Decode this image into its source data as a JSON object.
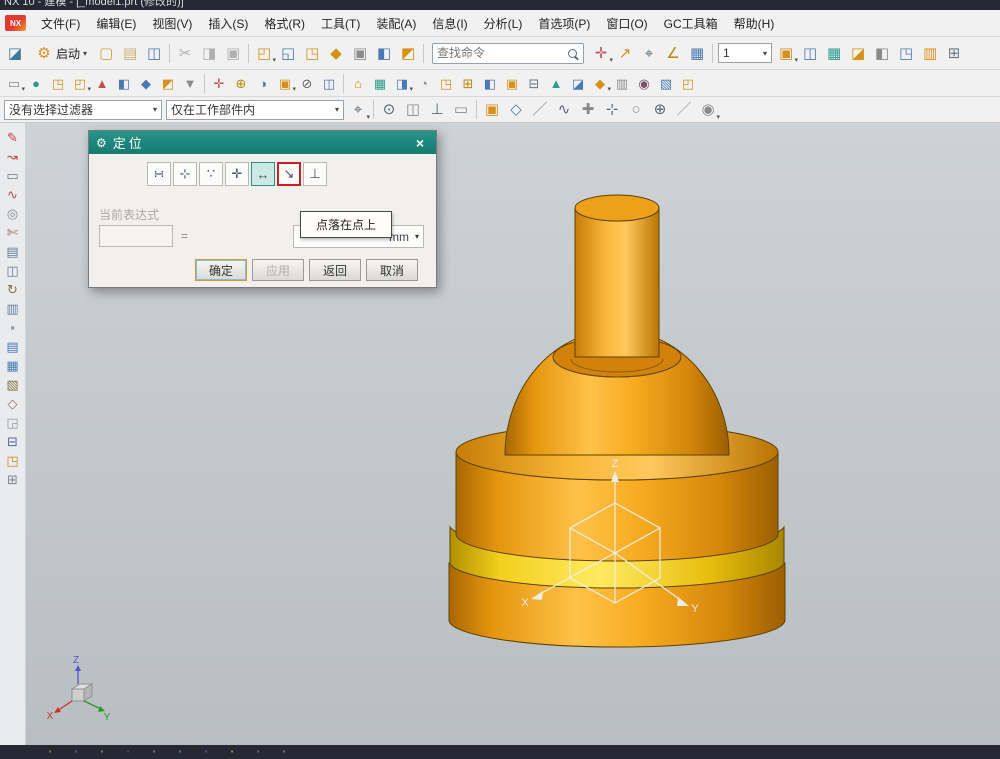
{
  "window": {
    "title": "NX 10 - 建模 - [_model1.prt (修改的)]",
    "logo": "NX"
  },
  "menu": {
    "items": [
      {
        "t": "文件(F)",
        "n": "menu-file"
      },
      {
        "t": "编辑(E)",
        "n": "menu-edit"
      },
      {
        "t": "视图(V)",
        "n": "menu-view"
      },
      {
        "t": "插入(S)",
        "n": "menu-insert"
      },
      {
        "t": "格式(R)",
        "n": "menu-format"
      },
      {
        "t": "工具(T)",
        "n": "menu-tools"
      },
      {
        "t": "装配(A)",
        "n": "menu-assemblies"
      },
      {
        "t": "信息(I)",
        "n": "menu-information"
      },
      {
        "t": "分析(L)",
        "n": "menu-analysis"
      },
      {
        "t": "首选项(P)",
        "n": "menu-preferences"
      },
      {
        "t": "窗口(O)",
        "n": "menu-window"
      },
      {
        "t": "GC工具箱",
        "n": "menu-gc-toolbox"
      },
      {
        "t": "帮助(H)",
        "n": "menu-help"
      }
    ]
  },
  "toolbar1": {
    "start_label": "启动",
    "search_placeholder": "查找命令",
    "zoom_value": "1",
    "icons_app": [
      {
        "g": "◪",
        "c": "#3a7a9a",
        "n": "app-home-icon"
      }
    ],
    "icons_b": [
      {
        "g": "▢",
        "c": "#caa23a",
        "n": "new-file-icon"
      },
      {
        "g": "▤",
        "c": "#c8b070",
        "n": "open-file-icon"
      },
      {
        "g": "◫",
        "c": "#4a7ab5",
        "n": "save-icon"
      },
      {
        "sep": 1
      },
      {
        "g": "✂",
        "c": "#b0b0b0",
        "n": "cut-icon"
      },
      {
        "g": "◨",
        "c": "#b0b0b0",
        "n": "copy-icon"
      },
      {
        "g": "▣",
        "c": "#b0b0b0",
        "n": "paste-icon"
      },
      {
        "sep": 1
      },
      {
        "g": "◰",
        "c": "#d8901a",
        "n": "feature-group-icon",
        "drop": 1
      },
      {
        "g": "◱",
        "c": "#4a7ab5",
        "n": "sketch-icon"
      },
      {
        "g": "◳",
        "c": "#d8901a",
        "n": "extrude-icon"
      },
      {
        "g": "◆",
        "c": "#d8901a",
        "n": "revolve-icon"
      },
      {
        "g": "▣",
        "c": "#8a8a8a",
        "n": "hole-icon"
      },
      {
        "g": "◧",
        "c": "#4a7ab5",
        "n": "unite-icon"
      },
      {
        "g": "◩",
        "c": "#d8901a",
        "n": "blend-icon"
      },
      {
        "sep": 1
      }
    ],
    "icons_c": [
      {
        "g": "✛",
        "c": "#c05050",
        "n": "point-dialog-icon",
        "drop": 1
      },
      {
        "g": "↗",
        "c": "#d8901a",
        "n": "vector-icon"
      },
      {
        "g": "⌖",
        "c": "#556677",
        "n": "csys-icon"
      },
      {
        "g": "∠",
        "c": "#b8860b",
        "n": "angle-icon"
      },
      {
        "g": "▦",
        "c": "#4a7ab5",
        "n": "pattern-icon"
      },
      {
        "sep": 1
      }
    ],
    "icons_d": [
      {
        "g": "▣",
        "c": "#d8901a",
        "n": "view-group-icon",
        "drop": 1
      },
      {
        "g": "◫",
        "c": "#4a7ab5",
        "n": "layer-settings-icon"
      },
      {
        "g": "▦",
        "c": "#2a9d8f",
        "n": "wcs-display-icon"
      },
      {
        "g": "◪",
        "c": "#d8901a",
        "n": "orient-view-icon"
      },
      {
        "g": "◧",
        "c": "#8a8a8a",
        "n": "section-view-icon"
      },
      {
        "g": "◳",
        "c": "#4a7ab5",
        "n": "shaded-view-icon"
      },
      {
        "g": "▥",
        "c": "#d8901a",
        "n": "wireframe-view-icon"
      },
      {
        "g": "⊞",
        "c": "#667788",
        "n": "grid-icon"
      }
    ]
  },
  "toolbar2": {
    "icons": [
      {
        "g": "▭",
        "c": "#8a8a8a",
        "n": "direct-sketch-icon",
        "drop": 1
      },
      {
        "g": "●",
        "c": "#2a9d8f",
        "n": "sphere-icon"
      },
      {
        "g": "◳",
        "c": "#d8901a",
        "n": "block-icon"
      },
      {
        "g": "◰",
        "c": "#d8901a",
        "n": "cylinder-icon",
        "drop": 1
      },
      {
        "g": "▲",
        "c": "#c05050",
        "n": "cone-icon"
      },
      {
        "g": "◧",
        "c": "#4a7ab5",
        "n": "boss-icon"
      },
      {
        "g": "◆",
        "c": "#4a7ab5",
        "n": "pocket-icon"
      },
      {
        "g": "◩",
        "c": "#d8901a",
        "n": "pad-icon"
      },
      {
        "g": "▼",
        "c": "#8a8a8a",
        "n": "emboss-icon"
      },
      {
        "sep": 1
      },
      {
        "g": "✛",
        "c": "#c05050",
        "n": "datum-csys-icon"
      },
      {
        "g": "⊕",
        "c": "#b8860b",
        "n": "datum-plane-icon"
      },
      {
        "g": "◑",
        "c": "#4a7ab5",
        "n": "trim-body-icon"
      },
      {
        "g": "▣",
        "c": "#d8901a",
        "n": "boolean-unite-icon",
        "drop": 1
      },
      {
        "g": "⊘",
        "c": "#666666",
        "n": "boolean-subtract-icon"
      },
      {
        "g": "◫",
        "c": "#4a7ab5",
        "n": "boolean-intersect-icon"
      },
      {
        "sep": 1
      },
      {
        "g": "⌂",
        "c": "#d8901a",
        "n": "shell-icon"
      },
      {
        "g": "▦",
        "c": "#2a9d8f",
        "n": "thread-icon"
      },
      {
        "g": "◨",
        "c": "#4a7ab5",
        "n": "draft-icon",
        "drop": 1
      },
      {
        "g": "◔",
        "c": "#8a8a8a",
        "n": "edge-blend-icon"
      },
      {
        "g": "◳",
        "c": "#d8901a",
        "n": "chamfer-icon"
      },
      {
        "g": "⊞",
        "c": "#b8860b",
        "n": "pattern-feature-icon"
      },
      {
        "g": "◧",
        "c": "#4a7ab5",
        "n": "mirror-feature-icon"
      },
      {
        "g": "▣",
        "c": "#d8901a",
        "n": "offset-face-icon"
      },
      {
        "g": "⊟",
        "c": "#667788",
        "n": "scale-body-icon"
      },
      {
        "g": "▲",
        "c": "#2a9d8f",
        "n": "tilt-icon"
      },
      {
        "g": "◪",
        "c": "#4a7ab5",
        "n": "move-face-icon"
      },
      {
        "g": "◆",
        "c": "#d8901a",
        "n": "copy-face-icon",
        "drop": 1
      },
      {
        "g": "▥",
        "c": "#8a8a8a",
        "n": "delete-face-icon"
      },
      {
        "g": "◉",
        "c": "#775566",
        "n": "synchronous-icon"
      },
      {
        "g": "▧",
        "c": "#4a7ab5",
        "n": "xform-icon"
      },
      {
        "g": "◰",
        "c": "#d8901a",
        "n": "replace-face-icon"
      }
    ]
  },
  "filterbar": {
    "filter_value": "没有选择过滤器",
    "scope_value": "仅在工作部件内",
    "icons": [
      {
        "g": "⌖",
        "c": "#556677",
        "n": "snap-point-icon",
        "drop": 1
      },
      {
        "sep": 1
      },
      {
        "g": "⊙",
        "c": "#556677",
        "n": "endpoint-snap-icon"
      },
      {
        "g": "◫",
        "c": "#8a8a8a",
        "n": "midpoint-snap-icon"
      },
      {
        "g": "⊥",
        "c": "#556677",
        "n": "intersection-snap-icon"
      },
      {
        "g": "▭",
        "c": "#8a8a8a",
        "n": "arc-center-snap-icon"
      },
      {
        "sep": 1
      },
      {
        "g": "▣",
        "c": "#d8901a",
        "n": "quadrant-snap-icon"
      },
      {
        "g": "◇",
        "c": "#4a7ab5",
        "n": "existing-point-snap-icon"
      },
      {
        "g": "／",
        "c": "#8a8a8a",
        "n": "point-on-curve-icon"
      },
      {
        "g": "∿",
        "c": "#556677",
        "n": "point-on-surface-icon"
      },
      {
        "g": "✚",
        "c": "#8a8a8a",
        "n": "two-point-icon"
      },
      {
        "g": "⊹",
        "c": "#556677",
        "n": "bounded-plane-icon"
      },
      {
        "g": "○",
        "c": "#8a8a8a",
        "n": "circle-snap-icon"
      },
      {
        "g": "⊕",
        "c": "#556677",
        "n": "sphere-center-icon"
      },
      {
        "g": "／",
        "c": "#999999",
        "n": "tangent-snap-icon"
      },
      {
        "g": "◉",
        "c": "#8a8a8a",
        "n": "snap-toggle-icon",
        "drop": 1
      }
    ]
  },
  "sidebar": {
    "icons": [
      {
        "g": "✎",
        "c": "#c04040",
        "n": "profile-icon"
      },
      {
        "g": "↝",
        "c": "#c04040",
        "n": "spline-icon"
      },
      {
        "g": "▭",
        "c": "#777777",
        "n": "rectangle-icon"
      },
      {
        "g": "∿",
        "c": "#b05050",
        "n": "studio-spline-icon"
      },
      {
        "g": "◎",
        "c": "#888888",
        "n": "polygon-icon"
      },
      {
        "g": "✄",
        "c": "#a06060",
        "n": "quick-trim-icon"
      },
      {
        "g": "▤",
        "c": "#6080a0",
        "n": "offset-curve-icon"
      },
      {
        "g": "◫",
        "c": "#6080a0",
        "n": "mirror-curve-icon"
      },
      {
        "g": "↻",
        "c": "#907040",
        "n": "pattern-curve-icon"
      },
      {
        "g": "▥",
        "c": "#6080a0",
        "n": "intersection-curve-icon"
      },
      {
        "g": "▪",
        "c": "#999999",
        "n": "more-separator-icon"
      },
      {
        "g": "▤",
        "c": "#4a7ab5",
        "n": "assembly-navigator-icon"
      },
      {
        "g": "▦",
        "c": "#4a7ab5",
        "n": "constraint-navigator-icon"
      },
      {
        "g": "▧",
        "c": "#887744",
        "n": "part-navigator-icon"
      },
      {
        "g": "◇",
        "c": "#a07070",
        "n": "reuse-library-icon"
      },
      {
        "g": "◲",
        "c": "#999999",
        "n": "hd3d-tools-icon"
      },
      {
        "g": "⊟",
        "c": "#5566aa",
        "n": "history-icon"
      },
      {
        "g": "◳",
        "c": "#cc8822",
        "n": "roles-icon"
      },
      {
        "g": "⊞",
        "c": "#778899",
        "n": "system-icon"
      }
    ]
  },
  "dialog": {
    "title": "定位",
    "close": "×",
    "gear": "⚙",
    "icons": [
      {
        "g": "∺",
        "n": "horizontal-dim-icon"
      },
      {
        "g": "⊹",
        "n": "vertical-dim-icon"
      },
      {
        "g": "∵",
        "n": "parallel-dim-icon"
      },
      {
        "g": "✛",
        "n": "perpendicular-dim-icon"
      },
      {
        "g": "↔",
        "n": "parallel-at-distance-icon",
        "cls": "sel"
      },
      {
        "g": "↘",
        "n": "point-onto-point-icon",
        "cls": "red"
      },
      {
        "g": "⊥",
        "n": "point-onto-line-icon"
      }
    ],
    "expression_label": "当前表达式",
    "equals": "=",
    "unit": "mm",
    "unit_arrow": "▾",
    "tooltip": "点落在点上",
    "buttons": {
      "ok": "确定",
      "apply": "应用",
      "back": "返回",
      "cancel": "取消"
    }
  },
  "viewport": {
    "wcs": {
      "x": "X",
      "y": "Y",
      "z": "Z"
    },
    "triad": {
      "x": "X",
      "y": "Y",
      "z": "Z"
    }
  },
  "statusbar": {
    "icons": [
      {
        "g": "▪",
        "c": "#8a6a3a",
        "n": "taskbar-icon"
      },
      {
        "g": "▪",
        "c": "#3a6a8a",
        "n": "taskbar-icon"
      },
      {
        "g": "▪",
        "c": "#6a8a3a",
        "n": "taskbar-icon"
      },
      {
        "g": "▪",
        "c": "#8a3a3a",
        "n": "taskbar-icon"
      },
      {
        "g": "▪",
        "c": "#777777",
        "n": "taskbar-icon"
      },
      {
        "g": "▪",
        "c": "#3a8a6a",
        "n": "taskbar-icon"
      },
      {
        "g": "▪",
        "c": "#55558a",
        "n": "taskbar-icon"
      },
      {
        "g": "▪",
        "c": "#8a8a3a",
        "n": "taskbar-icon"
      },
      {
        "g": "▪",
        "c": "#666666",
        "n": "taskbar-icon"
      },
      {
        "g": "▪",
        "c": "#8a6a6a",
        "n": "taskbar-icon"
      }
    ]
  }
}
